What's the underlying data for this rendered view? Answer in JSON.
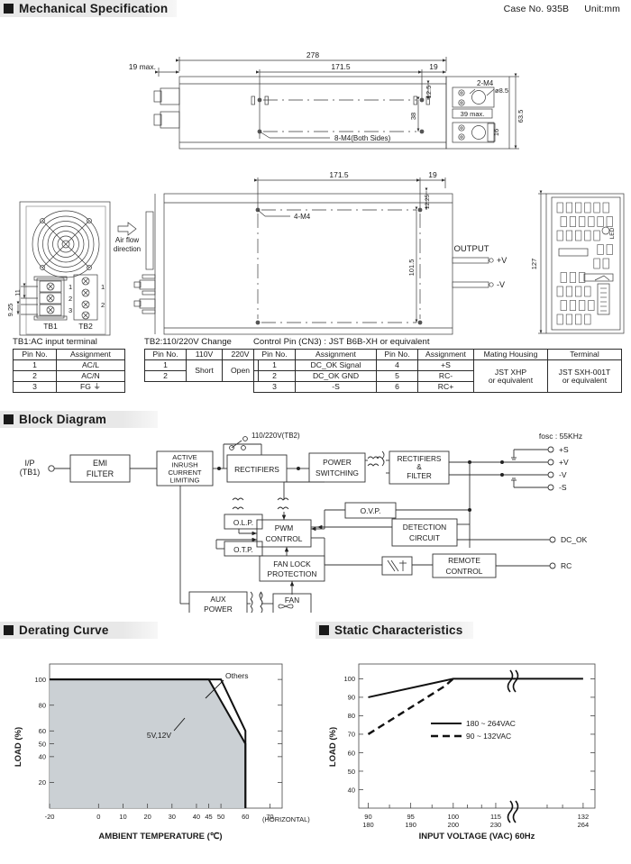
{
  "sections": {
    "mechanical": "Mechanical Specification",
    "block": "Block Diagram",
    "derating": "Derating Curve",
    "static": "Static Characteristics"
  },
  "header": {
    "case_no": "Case No. 935B",
    "unit": "Unit:mm"
  },
  "mech_drawing": {
    "top_view": {
      "dim_overall": "278",
      "dim_hole_span": "171.5",
      "dim_right_edge": "19",
      "dim_left_max": "19 max.",
      "dim_12_5": "12.5",
      "dim_38": "38",
      "note_8m4": "8-M4(Both Sides)",
      "note_2m4": "2-M4",
      "dim_phi": "ø8.5",
      "dim_39max": "39 max.",
      "dim_height": "63.5",
      "dim_16": "16"
    },
    "front_view": {
      "air_flow": "Air flow\ndirection",
      "air_flow_l1": "Air flow",
      "air_flow_l2": "direction",
      "tb1": "TB1",
      "tb2": "TB2",
      "tb1_pins": [
        "1",
        "2",
        "3"
      ],
      "tb2_pins": [
        "1",
        "2"
      ],
      "dim_11": "11",
      "dim_925": "9.25"
    },
    "bottom_view": {
      "dim_171_5": "171.5",
      "dim_19": "19",
      "dim_12_25": "12.25",
      "dim_101_5": "101.5",
      "note_4m4": "4-M4",
      "output": "OUTPUT",
      "plus_v": "+V",
      "minus_v": "-V"
    },
    "rear_view": {
      "dim_127": "127",
      "led": "LED"
    }
  },
  "tables": {
    "tb1": {
      "caption": "TB1:AC input terminal",
      "columns": [
        "Pin No.",
        "Assignment"
      ],
      "rows": [
        [
          "1",
          "AC/L"
        ],
        [
          "2",
          "AC/N"
        ],
        [
          "3",
          "FG ⏚"
        ]
      ]
    },
    "tb2": {
      "caption": "TB2:110/220V Change",
      "columns": [
        "Pin No.",
        "110V",
        "220V"
      ],
      "pins": [
        "1",
        "2"
      ],
      "v110": "Short",
      "v220": "Open"
    },
    "cn3": {
      "caption": "Control Pin (CN3) : JST B6B-XH or equivalent",
      "columns": [
        "Pin No.",
        "Assignment",
        "Pin No.",
        "Assignment",
        "Mating Housing",
        "Terminal"
      ],
      "rows": [
        [
          "1",
          "DC_OK Signal",
          "4",
          "+S"
        ],
        [
          "2",
          "DC_OK GND",
          "5",
          "RC-"
        ],
        [
          "3",
          "-S",
          "6",
          "RC+"
        ]
      ],
      "mating_housing_l1": "JST XHP",
      "mating_housing_l2": "or equivalent",
      "terminal_l1": "JST SXH-001T",
      "terminal_l2": "or equivalent"
    }
  },
  "block_diagram": {
    "input_l1": "I/P",
    "input_l2": "(TB1)",
    "emi_l1": "EMI",
    "emi_l2": "FILTER",
    "active_l1": "ACTIVE",
    "active_l2": "INRUSH",
    "active_l3": "CURRENT",
    "active_l4": "LIMITING",
    "rectifiers": "RECTIFIERS",
    "switch_sel": "110/220V(TB2)",
    "power_l1": "POWER",
    "power_l2": "SWITCHING",
    "rectfilt_l1": "RECTIFIERS",
    "rectfilt_l2": "&",
    "rectfilt_l3": "FILTER",
    "fosc": "fosc : 55KHz",
    "out_plus_s": "+S",
    "out_plus_v": "+V",
    "out_minus_v": "-V",
    "out_minus_s": "-S",
    "olp": "O.L.P.",
    "otp": "O.T.P.",
    "ovp": "O.V.P.",
    "pwm_l1": "PWM",
    "pwm_l2": "CONTROL",
    "detect_l1": "DETECTION",
    "detect_l2": "CIRCUIT",
    "dc_ok": "DC_OK",
    "fanlock_l1": "FAN LOCK",
    "fanlock_l2": "PROTECTION",
    "remote_l1": "REMOTE",
    "remote_l2": "CONTROL",
    "rc": "RC",
    "aux_l1": "AUX",
    "aux_l2": "POWER",
    "fan": "FAN"
  },
  "chart_data": [
    {
      "type": "line",
      "title": "Derating Curve",
      "xlabel": "AMBIENT TEMPERATURE (℃)",
      "ylabel": "LOAD (%)",
      "xlim": [
        -20,
        75
      ],
      "ylim": [
        0,
        112
      ],
      "xticks": [
        -20,
        0,
        10,
        20,
        30,
        40,
        45,
        50,
        60,
        70
      ],
      "xtick_labels": [
        "-20",
        "0",
        "10",
        "20",
        "30",
        "40",
        "45",
        "50",
        "60",
        "70"
      ],
      "yticks": [
        20,
        40,
        50,
        60,
        80,
        100
      ],
      "ytick_labels": [
        "20",
        "40",
        "50",
        "60",
        "80",
        "100"
      ],
      "grid": false,
      "annotation_horizontal": "(HORIZONTAL)",
      "series": [
        {
          "name": "Others",
          "label": "Others",
          "x": [
            -20,
            50,
            60
          ],
          "y": [
            100,
            100,
            60
          ]
        },
        {
          "name": "5V,12V",
          "label": "5V,12V",
          "x": [
            -20,
            45,
            60
          ],
          "y": [
            100,
            100,
            50
          ]
        }
      ],
      "shaded_region": true
    },
    {
      "type": "line",
      "title": "Static Characteristics",
      "xlabel": "INPUT VOLTAGE (VAC) 60Hz",
      "ylabel": "LOAD (%)",
      "ylim": [
        30,
        108
      ],
      "yticks": [
        40,
        50,
        60,
        70,
        80,
        90,
        100
      ],
      "ytick_labels": [
        "40",
        "50",
        "60",
        "70",
        "80",
        "90",
        "100"
      ],
      "xtick_labels_top": [
        "90",
        "95",
        "100",
        "115",
        "132"
      ],
      "xtick_labels_bottom": [
        "180",
        "190",
        "200",
        "230",
        "264"
      ],
      "axis_break": true,
      "grid": false,
      "legend_position": "center",
      "series": [
        {
          "name": "180 ~ 264VAC",
          "label": "180 ~ 264VAC",
          "style": "solid",
          "x": [
            90,
            100,
            132
          ],
          "y": [
            90,
            100,
            100
          ]
        },
        {
          "name": "90 ~ 132VAC",
          "label": "90 ~ 132VAC",
          "style": "dashed",
          "x": [
            90,
            99,
            100
          ],
          "y": [
            70,
            96,
            100
          ]
        }
      ]
    }
  ]
}
